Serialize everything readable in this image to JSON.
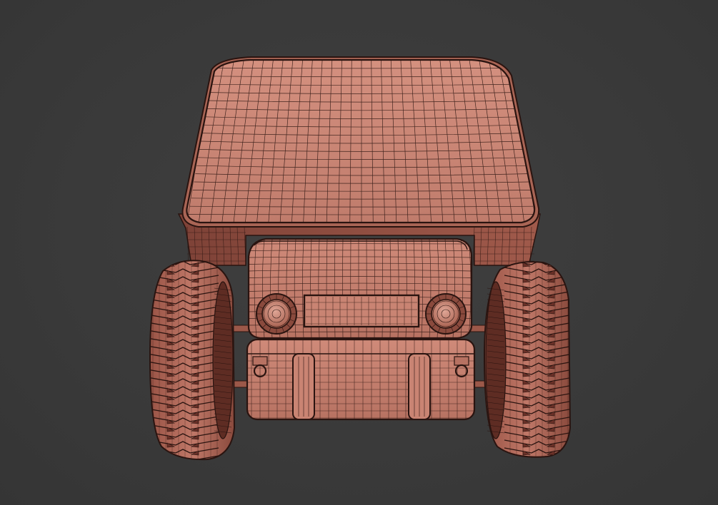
{
  "scene": {
    "subject": "vehicle-wireframe-front-view",
    "colors": {
      "background": "#3b3b3b",
      "body": "#c98473",
      "body_shadow": "#8e4f43",
      "tire": "#b06a5a",
      "tire_dark": "#6a3128",
      "wire": "#2a1410",
      "headlight_glass": "#d69a8b"
    }
  }
}
